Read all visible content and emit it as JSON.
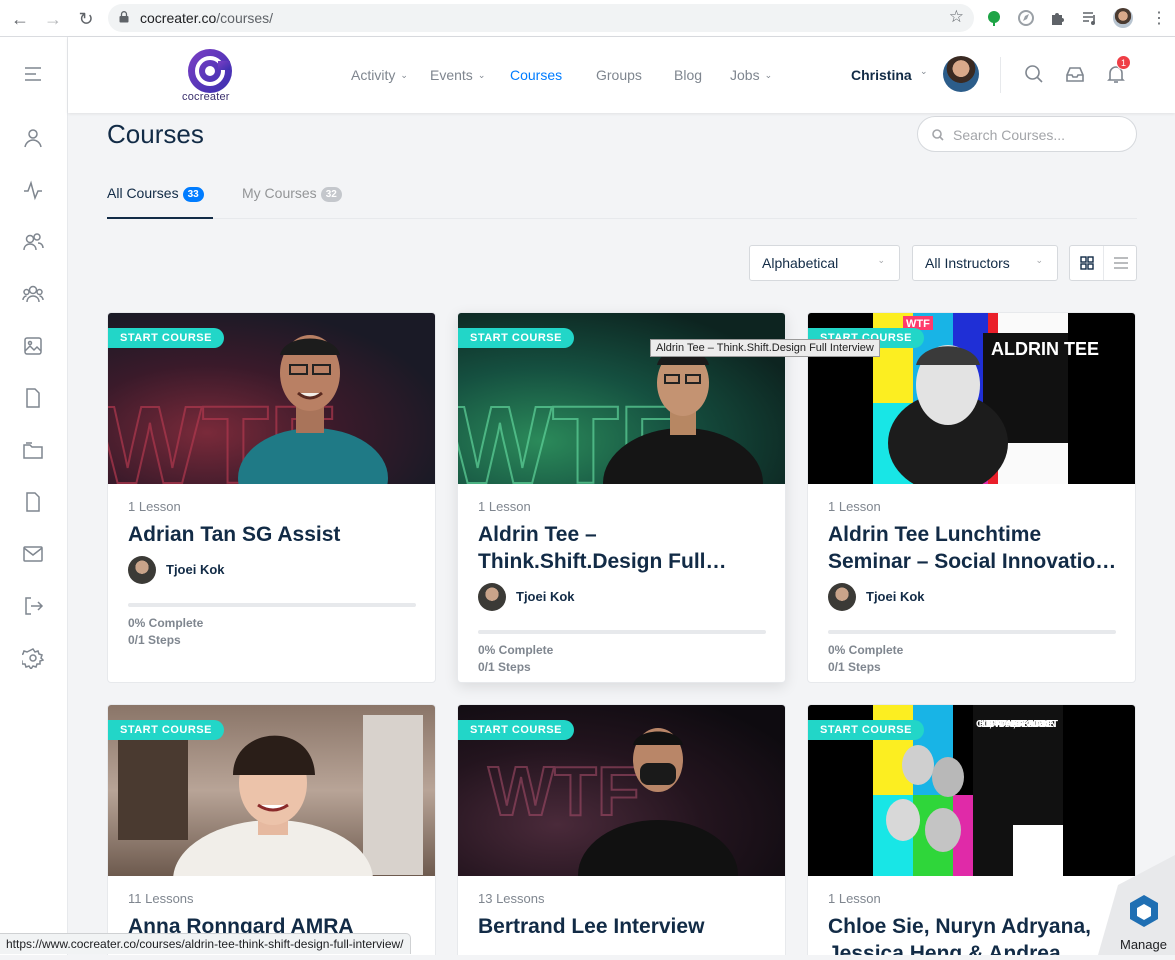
{
  "browser": {
    "url_host": "cocreater.co",
    "url_path": "/courses/",
    "status_url": "https://www.cocreater.co/courses/aldrin-tee-think-shift-design-full-interview/",
    "manage_label": "Manage"
  },
  "header": {
    "logo_text": "cocreater",
    "menu": [
      {
        "label": "Activity",
        "has_dropdown": true,
        "active": false
      },
      {
        "label": "Events",
        "has_dropdown": true,
        "active": false
      },
      {
        "label": "Courses",
        "has_dropdown": false,
        "active": true
      },
      {
        "label": "Groups",
        "has_dropdown": false,
        "active": false
      },
      {
        "label": "Blog",
        "has_dropdown": false,
        "active": false
      },
      {
        "label": "Jobs",
        "has_dropdown": true,
        "active": false
      }
    ],
    "user_name": "Christina",
    "notification_count": "1",
    "accent_color": "#007cff"
  },
  "sidebar": {
    "icons": [
      "menu-icon",
      "profile-icon",
      "activity-icon",
      "connections-icon",
      "groups-icon",
      "photos-icon",
      "documents-icon",
      "folders-icon",
      "forums-icon",
      "messages-icon",
      "logout-icon",
      "settings-icon"
    ]
  },
  "page": {
    "title": "Courses",
    "search_placeholder": "Search Courses...",
    "tabs": [
      {
        "label": "All Courses",
        "count": "33",
        "active": true
      },
      {
        "label": "My Courses",
        "count": "32",
        "active": false
      }
    ],
    "sort_select": "Alphabetical",
    "instructor_select": "All Instructors",
    "tooltip": "Aldrin Tee – Think.Shift.Design Full Interview"
  },
  "courses": [
    {
      "badge": "START COURSE",
      "lessons": "1 Lesson",
      "title": "Adrian Tan SG Assist",
      "instructor": "Tjoei Kok",
      "complete": "0% Complete",
      "steps": "0/1 Steps",
      "progress": 0
    },
    {
      "badge": "START COURSE",
      "lessons": "1 Lesson",
      "title": "Aldrin Tee – Think.Shift.Design Full…",
      "instructor": "Tjoei Kok",
      "complete": "0% Complete",
      "steps": "0/1 Steps",
      "progress": 0
    },
    {
      "badge": "START COURSE",
      "lessons": "1 Lesson",
      "title": "Aldrin Tee Lunchtime Seminar – Social Innovatio…",
      "instructor": "Tjoei Kok",
      "complete": "0% Complete",
      "steps": "0/1 Steps",
      "progress": 0,
      "poster": {
        "tag": "WTF",
        "name": "ALDRIN TEE"
      }
    },
    {
      "badge": "START COURSE",
      "lessons": "11 Lessons",
      "title": "Anna Ronngard AMRA"
    },
    {
      "badge": "START COURSE",
      "lessons": "13 Lessons",
      "title": "Bertrand Lee Interview"
    },
    {
      "badge": "START COURSE",
      "lessons": "1 Lesson",
      "title": "Chloe Sie, Nuryn Adryana, Jessica Heng & Andrea…",
      "poster": {
        "names": "CHLOE SIE, NURYN ADRYANA, JESSICA HENG & ANDREA VINCENT"
      }
    }
  ]
}
